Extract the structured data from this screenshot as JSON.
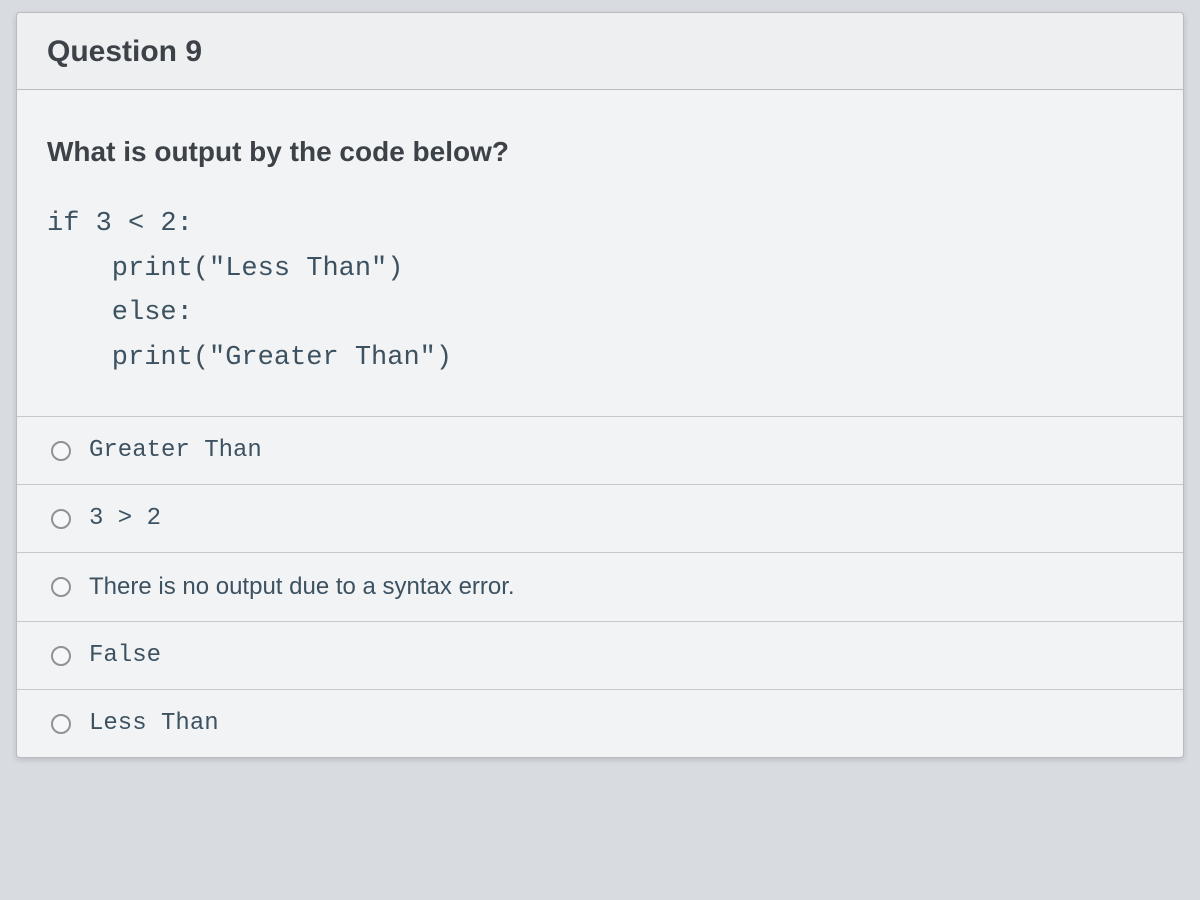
{
  "question": {
    "header": "Question 9",
    "prompt": "What is output by the code below?",
    "code": "if 3 < 2:\n    print(\"Less Than\")\n    else:\n    print(\"Greater Than\")",
    "answers": [
      {
        "label": "Greater Than",
        "font": "mono"
      },
      {
        "label": "3 > 2",
        "font": "mono"
      },
      {
        "label": "There is no output due to a syntax error.",
        "font": "sans"
      },
      {
        "label": "False",
        "font": "mono"
      },
      {
        "label": "Less Than",
        "font": "mono"
      }
    ]
  }
}
